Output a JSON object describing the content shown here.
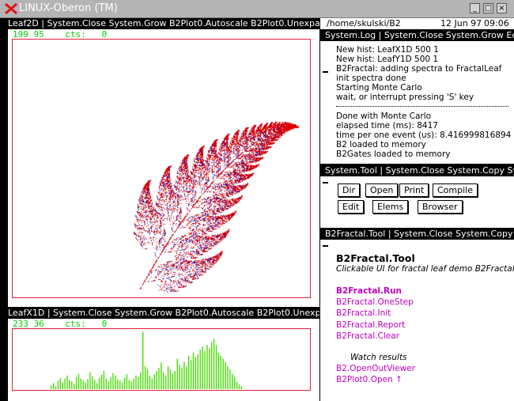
{
  "window": {
    "title": "LINUX-Oberon (TM)",
    "btn_min": "_",
    "btn_max": "□",
    "btn_close": "×"
  },
  "leaf2d": {
    "menu": "Leaf2D | System.Close System.Grow B2Plot0.Autoscale B2Plot0.Unexpand",
    "status": "199 95    cts:   0"
  },
  "leafx1d": {
    "menu": "LeafX1D | System.Close System.Grow B2Plot0.Autoscale B2Plot0.Unexpand",
    "status": "233 36    cts:   0"
  },
  "right_header": {
    "path": "/home/skulski/B2",
    "date": "12 Jun 97",
    "time": "09:06"
  },
  "log": {
    "menu": "System.Log | System.Close System.Grow Edit.L",
    "lines_top": [
      "New hist: LeafX1D 500 1",
      "New hist: LeafY1D 500 1",
      "B2Fractal: adding spectra to FractalLeaf",
      "init spectra done",
      "Starting Monte Carlo",
      "wait, or interrupt pressing 'S' key"
    ],
    "lines_bottom": [
      "Done with Monte Carlo",
      "elapsed time (ms):  8417",
      "time per one event (us):   8.416999816894",
      "B2 loaded to memory",
      "B2Gates loaded to memory"
    ]
  },
  "systool": {
    "menu": "System.Tool | System.Close System.Copy Syste",
    "buttons": [
      "Dir",
      "Open",
      "Print",
      "Compile",
      "Edit",
      "Elems",
      "Browser"
    ]
  },
  "b2tool": {
    "menu": "B2Fractal.Tool | System.Close System.Copy Sys",
    "title": "B2Fractal.Tool",
    "subtitle": "Clickable UI for fractal leaf demo B2Fractal.M",
    "commands": [
      "B2Fractal.Run",
      "B2Fractal.OneStep",
      "B2Fractal.Init",
      "B2Fractal.Report",
      "B2Fractal.Clear"
    ],
    "watch": "Watch results",
    "viewers": [
      "B2.OpenOutViewer",
      "B2Plot0.Open ↑"
    ]
  },
  "colors": {
    "frame_red": "#e0203a",
    "status_green": "#00d000",
    "command_magenta": "#c000c0",
    "hist_green": "#44dd00"
  },
  "chart_data": [
    {
      "type": "scatter",
      "name": "Leaf2D",
      "description_series": "fractal leaf density"
    },
    {
      "type": "bar",
      "name": "LeafX1D",
      "values": [
        5,
        8,
        4,
        11,
        15,
        9,
        14,
        18,
        12,
        10,
        7,
        16,
        20,
        14,
        11,
        9,
        13,
        22,
        17,
        12,
        8,
        15,
        19,
        24,
        14,
        10,
        16,
        21,
        18,
        13,
        11,
        9,
        15,
        20,
        12,
        10,
        14,
        18,
        16,
        22,
        75,
        30,
        26,
        18,
        14,
        20,
        24,
        28,
        35,
        22,
        18,
        30,
        26,
        20,
        24,
        40,
        32,
        28,
        36,
        30,
        44,
        38,
        48,
        42,
        46,
        52,
        56,
        50,
        58,
        54,
        62,
        66,
        58,
        48,
        44,
        40,
        36,
        30,
        26,
        20,
        16,
        10,
        6,
        4
      ]
    }
  ]
}
